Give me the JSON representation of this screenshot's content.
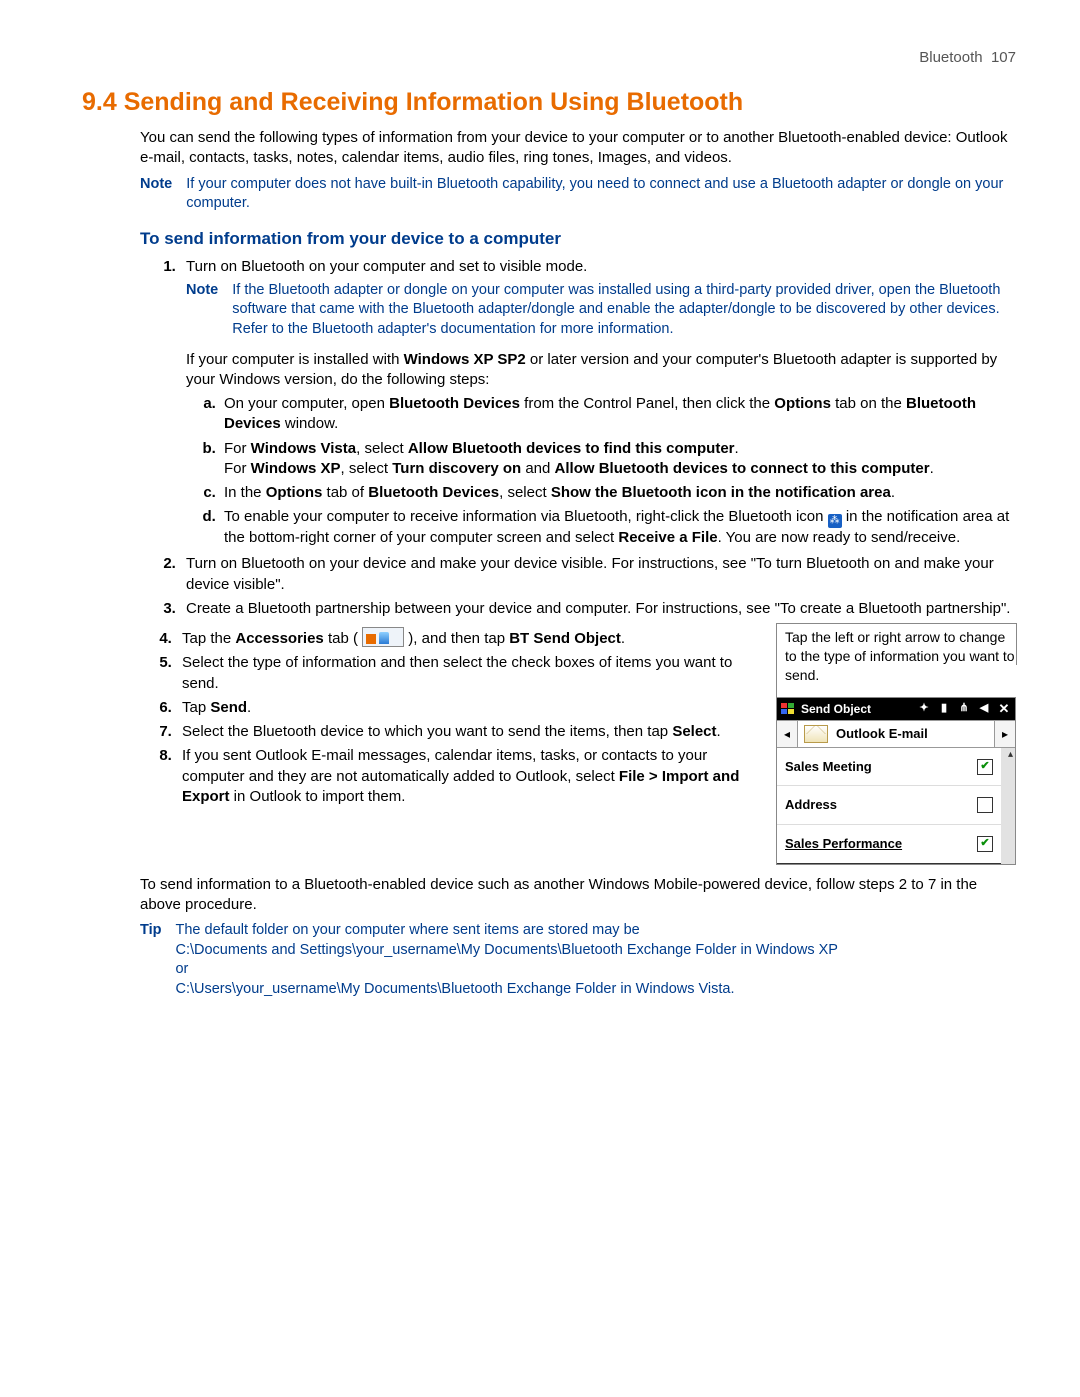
{
  "header": {
    "section": "Bluetooth",
    "page": "107"
  },
  "h1": "9.4  Sending and Receiving Information Using Bluetooth",
  "intro": "You can send the following types of information from your device to your computer or to another Bluetooth-enabled device: Outlook e-mail, contacts, tasks, notes, calendar items, audio files, ring tones, Images, and videos.",
  "note1": {
    "label": "Note",
    "body": "If your computer does not have built-in Bluetooth capability, you need to connect and use a Bluetooth adapter or dongle on your computer."
  },
  "h2": "To send information from your device to a computer",
  "s1": {
    "t": "Turn on Bluetooth on your computer and set to visible mode.",
    "note": {
      "label": "Note",
      "body": "If the Bluetooth adapter or dongle on your computer was installed using a third-party provided driver, open the Bluetooth software that came with the Bluetooth adapter/dongle and enable the adapter/dongle to be discovered by other devices. Refer to the Bluetooth adapter's documentation for more information."
    },
    "post1": "If your computer is installed with ",
    "post_b1": "Windows XP SP2",
    "post2": " or later version and your computer's Bluetooth adapter is supported by your Windows version, do the following steps:",
    "a": {
      "p1": "On your computer, open ",
      "b1": "Bluetooth Devices",
      "p2": " from the Control Panel, then click the ",
      "b2": "Options",
      "p3": " tab on the ",
      "b3": "Bluetooth Devices",
      "p4": " window."
    },
    "b": {
      "p1": "For ",
      "b1": "Windows Vista",
      "p2": ", select ",
      "b2": "Allow Bluetooth devices to find this computer",
      "p3": ".",
      "br": "For ",
      "b3": "Windows XP",
      "p4": ", select ",
      "b4": "Turn discovery on",
      "p5": " and ",
      "b5": "Allow Bluetooth devices to connect to this computer",
      "p6": "."
    },
    "c": {
      "p1": "In the ",
      "b1": "Options",
      "p2": " tab of ",
      "b2": "Bluetooth Devices",
      "p3": ", select ",
      "b3": "Show the Bluetooth icon in the notification area",
      "p4": "."
    },
    "d": {
      "p1": "To enable your computer to receive information via Bluetooth, right-click the Bluetooth icon ",
      "p2": " in the notification area at the bottom-right corner of your computer screen and select ",
      "b1": "Receive a File",
      "p3": ". You are now ready to send/receive."
    }
  },
  "s2": "Turn on Bluetooth on your device and make your device visible. For instructions, see \"To turn Bluetooth on and make your device visible\".",
  "s3": "Create a Bluetooth partnership between your device and computer. For instructions, see \"To create a Bluetooth partnership\".",
  "s4": {
    "p1": "Tap the ",
    "b1": "Accessories",
    "p2": " tab ( ",
    "p3": " ), and then tap ",
    "b2": "BT Send Object",
    "p4": "."
  },
  "s5": "Select the type of information and then select the check boxes of items you want to send.",
  "s6": {
    "p1": "Tap ",
    "b1": "Send",
    "p2": "."
  },
  "s7": {
    "p1": "Select the Bluetooth device to which you want to send the items, then tap ",
    "b1": "Select",
    "p2": "."
  },
  "s8": {
    "p1": "If you sent Outlook E-mail messages, calendar items, tasks, or contacts to your computer and they are not automatically added to Outlook, select ",
    "b1": "File > Import and Export",
    "p2": " in Outlook to import them."
  },
  "figure": {
    "caption": "Tap the left or right arrow to change to the type of information you want to send.",
    "title": "Send Object",
    "selector": "Outlook E-mail",
    "items": [
      {
        "label": "Sales Meeting",
        "checked": true
      },
      {
        "label": "Address",
        "checked": false
      },
      {
        "label": "Sales Performance",
        "checked": true
      }
    ]
  },
  "after_fig": "To send information to a Bluetooth-enabled device such as another Windows Mobile-powered device, follow steps 2 to 7 in the above procedure.",
  "tip": {
    "label": "Tip",
    "l1": "The default folder on your computer where sent items are stored may be",
    "l2": "C:\\Documents and Settings\\your_username\\My Documents\\Bluetooth Exchange Folder in Windows XP",
    "l3": "or",
    "l4": "C:\\Users\\your_username\\My Documents\\Bluetooth Exchange Folder in Windows Vista."
  }
}
